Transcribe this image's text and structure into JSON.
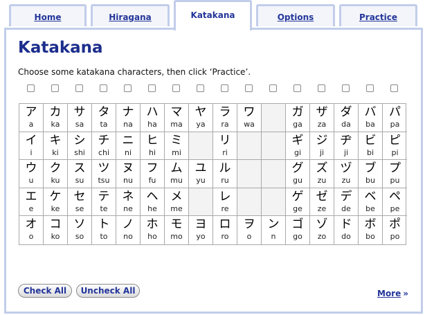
{
  "tabs": [
    {
      "label": "Home",
      "active": false
    },
    {
      "label": "Hiragana",
      "active": false
    },
    {
      "label": "Katakana",
      "active": true
    },
    {
      "label": "Options",
      "active": false
    },
    {
      "label": "Practice",
      "active": false
    }
  ],
  "page_title": "Katakana",
  "instruction": "Choose some katakana characters, then click ‘Practice’.",
  "columns": [
    [
      "ア",
      "a",
      "イ",
      "i",
      "ウ",
      "u",
      "エ",
      "e",
      "オ",
      "o"
    ],
    [
      "カ",
      "ka",
      "キ",
      "ki",
      "ク",
      "ku",
      "ケ",
      "ke",
      "コ",
      "ko"
    ],
    [
      "サ",
      "sa",
      "シ",
      "shi",
      "ス",
      "su",
      "セ",
      "se",
      "ソ",
      "so"
    ],
    [
      "タ",
      "ta",
      "チ",
      "chi",
      "ツ",
      "tsu",
      "テ",
      "te",
      "ト",
      "to"
    ],
    [
      "ナ",
      "na",
      "ニ",
      "ni",
      "ヌ",
      "nu",
      "ネ",
      "ne",
      "ノ",
      "no"
    ],
    [
      "ハ",
      "ha",
      "ヒ",
      "hi",
      "フ",
      "fu",
      "ヘ",
      "he",
      "ホ",
      "ho"
    ],
    [
      "マ",
      "ma",
      "ミ",
      "mi",
      "ム",
      "mu",
      "メ",
      "me",
      "モ",
      "mo"
    ],
    [
      "ヤ",
      "ya",
      "",
      "",
      "ユ",
      "yu",
      "",
      "",
      "ヨ",
      "yo"
    ],
    [
      "ラ",
      "ra",
      "リ",
      "ri",
      "ル",
      "ru",
      "レ",
      "re",
      "ロ",
      "ro"
    ],
    [
      "ワ",
      "wa",
      "",
      "",
      "",
      "",
      "",
      "",
      "ヲ",
      "o"
    ],
    [
      "",
      "",
      "",
      "",
      "",
      "",
      "",
      "",
      "ン",
      "n"
    ],
    [
      "ガ",
      "ga",
      "ギ",
      "gi",
      "グ",
      "gu",
      "ゲ",
      "ge",
      "ゴ",
      "go"
    ],
    [
      "ザ",
      "za",
      "ジ",
      "ji",
      "ズ",
      "zu",
      "ゼ",
      "ze",
      "ゾ",
      "zo"
    ],
    [
      "ダ",
      "da",
      "ヂ",
      "ji",
      "ヅ",
      "zu",
      "デ",
      "de",
      "ド",
      "do"
    ],
    [
      "バ",
      "ba",
      "ビ",
      "bi",
      "ブ",
      "bu",
      "ベ",
      "be",
      "ボ",
      "bo"
    ],
    [
      "パ",
      "pa",
      "ピ",
      "pi",
      "プ",
      "pu",
      "ペ",
      "pe",
      "ポ",
      "po"
    ]
  ],
  "check_all_label": "Check All",
  "uncheck_all_label": "Uncheck All",
  "more_label": "More",
  "more_arrow": "»",
  "colors": {
    "accent": "#23359a",
    "tab_border": "#c2cdea",
    "empty_cell": "#f3f3f3"
  }
}
